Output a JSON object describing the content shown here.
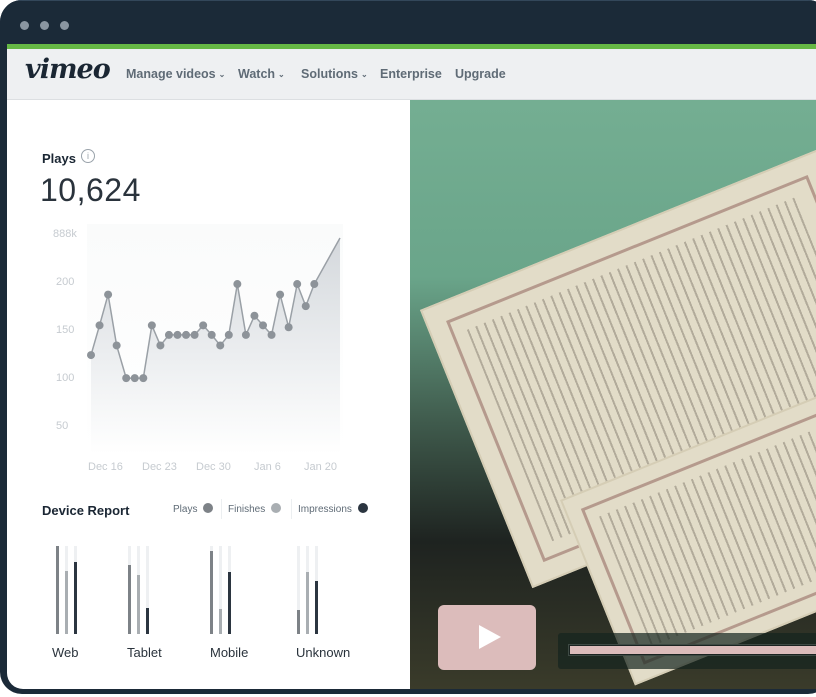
{
  "window": {
    "traffic_lights": [
      "close",
      "minimize",
      "maximize"
    ]
  },
  "navbar": {
    "logo": "vimeo",
    "items": [
      {
        "label": "Manage videos",
        "has_dropdown": true
      },
      {
        "label": "Watch",
        "has_dropdown": true
      },
      {
        "label": "Solutions",
        "has_dropdown": true
      },
      {
        "label": "Enterprise",
        "has_dropdown": false
      },
      {
        "label": "Upgrade",
        "has_dropdown": false
      }
    ],
    "dropdown_glyph": "⌄"
  },
  "stats": {
    "plays_label": "Plays",
    "info_icon": "i",
    "plays_value": "10,624"
  },
  "chart_data": {
    "type": "area",
    "title": "Plays",
    "xlabel": "",
    "ylabel": "",
    "y_ticks": [
      "888k",
      "200",
      "150",
      "100",
      "50"
    ],
    "x_ticks": [
      "Dec 16",
      "Dec 23",
      "Dec 30",
      "Jan 6",
      "Jan 20"
    ],
    "ylim": [
      0,
      250
    ],
    "grid": false,
    "marker_values": [
      102,
      133,
      165,
      112,
      78,
      78,
      78,
      133,
      112,
      123,
      123,
      123,
      123,
      133,
      123,
      112,
      123,
      176,
      123,
      143,
      133,
      123,
      165,
      131,
      176,
      153,
      176
    ],
    "final_value": 224,
    "colors": {
      "line": "#9aa0a6",
      "marker": "#8d9399",
      "fill_top": "#d9dde1",
      "fill_bottom": "#ffffff"
    }
  },
  "device_report": {
    "title": "Device Report",
    "legend": [
      {
        "label": "Plays",
        "color": "#7d8287"
      },
      {
        "label": "Finishes",
        "color": "#a9aeb2"
      },
      {
        "label": "Impressions",
        "color": "#2b3540"
      }
    ],
    "devices": [
      {
        "label": "Web",
        "plays": 1.0,
        "finishes": 0.72,
        "impressions": 0.82
      },
      {
        "label": "Tablet",
        "plays": 0.78,
        "finishes": 0.67,
        "impressions": 0.29
      },
      {
        "label": "Mobile",
        "plays": 0.94,
        "finishes": 0.28,
        "impressions": 0.7
      },
      {
        "label": "Unknown",
        "plays": 0.27,
        "finishes": 0.7,
        "impressions": 0.6
      }
    ]
  },
  "video_player": {
    "play_icon": "play",
    "progress": 1.0,
    "accent_color": "#dcbcbb"
  }
}
